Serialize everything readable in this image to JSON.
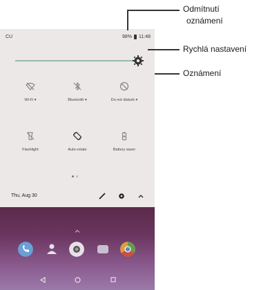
{
  "status": {
    "carrier": "CU",
    "battery": "98%",
    "time": "11:48"
  },
  "tiles": [
    {
      "label": "Wi-Fi ▾",
      "icon": "wifi-off-icon"
    },
    {
      "label": "Bluetooth ▾",
      "icon": "bluetooth-off-icon"
    },
    {
      "label": "Do not disturb ▾",
      "icon": "do-not-disturb-icon"
    },
    {
      "label": "Flashlight",
      "icon": "flashlight-icon"
    },
    {
      "label": "Auto-rotate",
      "icon": "auto-rotate-icon"
    },
    {
      "label": "Battery saver",
      "icon": "battery-saver-icon"
    }
  ],
  "date": "Thu, Aug 30",
  "callouts": {
    "dismiss_line1": "Odmítnutí",
    "dismiss_line2": "oznámení",
    "quick_settings": "Rychlá nastavení",
    "notifications": "Oznámení"
  },
  "colors": {
    "panel": "#ece8e8",
    "slider": "#98b8b0",
    "wallpaper": "#6b3660"
  }
}
